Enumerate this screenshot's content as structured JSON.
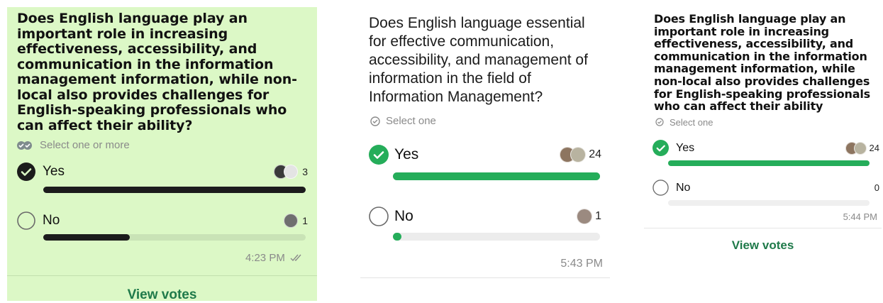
{
  "polls": [
    {
      "question": "Does English language play an important role in increasing effectiveness, accessibility, and communication in the information management information, while non-local also provides challenges for English-speaking professionals who can affect their ability?",
      "hint": "Select one or more",
      "options": [
        {
          "label": "Yes",
          "count": "3",
          "fill_fraction": 1.0,
          "selected": true,
          "voter_avatars": 2
        },
        {
          "label": "No",
          "count": "1",
          "fill_fraction": 0.33,
          "selected": false,
          "voter_avatars": 1
        }
      ],
      "timestamp": "4:23 PM",
      "view_votes_label": "View votes",
      "colors": {
        "background": "#dcf8c6",
        "accent": "#1c1c1c",
        "link": "#1f7a4a"
      }
    },
    {
      "question": "Does English language essential for effective communication, accessibility, and management of information in the field of Information Management?",
      "hint": "Select one",
      "options": [
        {
          "label": "Yes",
          "count": "24",
          "fill_fraction": 1.0,
          "selected": true,
          "voter_avatars": 2
        },
        {
          "label": "No",
          "count": "1",
          "fill_fraction": 0.04,
          "selected": false,
          "voter_avatars": 1
        }
      ],
      "timestamp": "5:43 PM",
      "colors": {
        "background": "#ffffff",
        "accent": "#25ad5a"
      }
    },
    {
      "question": "Does English language play an important role in increasing effectiveness, accessibility, and communication in the information management information, while non-local also provides challenges for English-speaking professionals who can affect their ability",
      "hint": "Select one",
      "options": [
        {
          "label": "Yes",
          "count": "24",
          "fill_fraction": 1.0,
          "selected": true,
          "voter_avatars": 2
        },
        {
          "label": "No",
          "count": "0",
          "fill_fraction": 0.0,
          "selected": false,
          "voter_avatars": 0
        }
      ],
      "timestamp": "5:44 PM",
      "view_votes_label": "View votes",
      "colors": {
        "background": "#ffffff",
        "accent": "#25ad5a",
        "link": "#1f7a4a"
      }
    }
  ],
  "icons": {
    "double_check": "double-check-icon",
    "select_one": "check-circle-icon",
    "select_many": "double-check-circle-icon",
    "checked": "checked-circle-icon",
    "unchecked": "empty-circle-icon"
  }
}
